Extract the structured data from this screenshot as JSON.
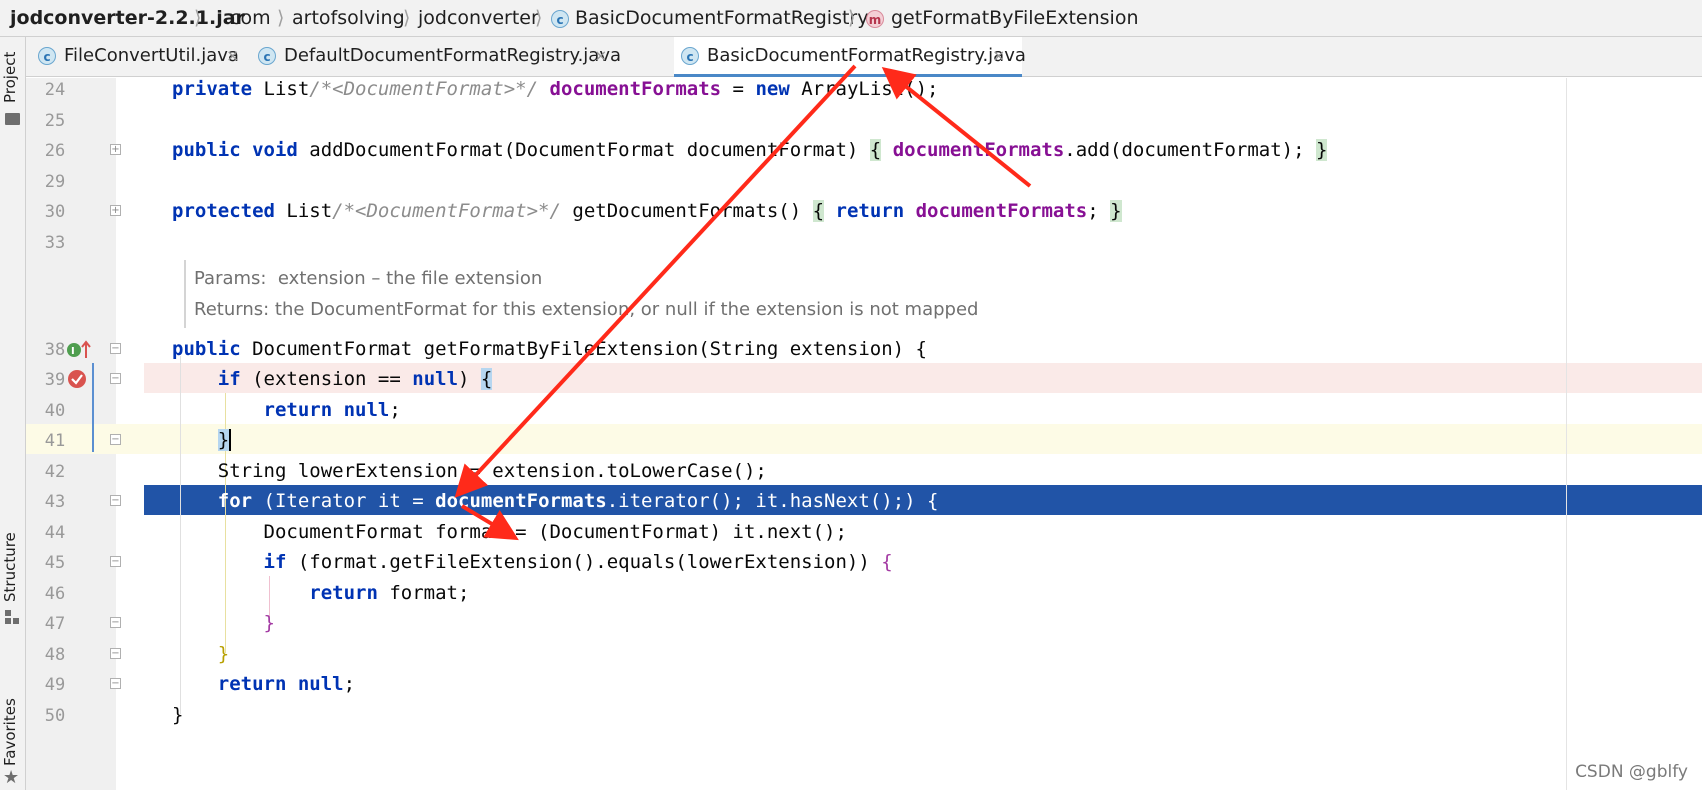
{
  "breadcrumb": {
    "items": [
      "jodconverter-2.2.1.jar",
      "com",
      "artofsolving",
      "jodconverter",
      "BasicDocumentFormatRegistry",
      "getFormatByFileExtension"
    ],
    "separator": "⟩"
  },
  "toolstrip": {
    "project_label": "Project",
    "structure_label": "Structure",
    "favorites_label": "Favorites"
  },
  "tabs": [
    {
      "label": "FileConvertUtil.java",
      "close": "×"
    },
    {
      "label": "DefaultDocumentFormatRegistry.java",
      "close": "×"
    },
    {
      "label": "BasicDocumentFormatRegistry.java",
      "close": "×"
    }
  ],
  "badges": {
    "class": "c",
    "method": "m"
  },
  "editor": {
    "line_numbers": [
      "24",
      "25",
      "26",
      "29",
      "30",
      "33",
      "38",
      "39",
      "40",
      "41",
      "42",
      "43",
      "44",
      "45",
      "46",
      "47",
      "48",
      "49",
      "50"
    ],
    "doc_params": "Params:  extension – the file extension",
    "doc_returns": "Returns: the DocumentFormat for this extension, or null if the extension is not mapped"
  },
  "colors": {
    "keyword": "#0033b3",
    "field": "#871094",
    "comment": "#8c8c8c",
    "selection": "#2154a7",
    "breakpoint": "#d9534f",
    "annotation_arrow": "#ff2a1a"
  },
  "watermark": "CSDN @gblfy"
}
